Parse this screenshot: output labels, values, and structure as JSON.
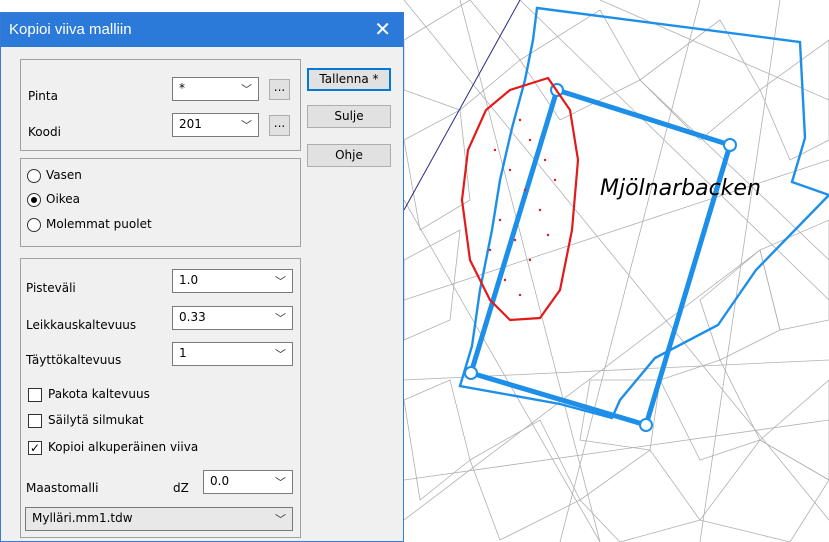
{
  "map": {
    "place_label": "Mjölnarbacken",
    "colors": {
      "tin": "#aaaaaa",
      "boundary": "#1e8fe8",
      "selection": "#ff0000",
      "axis": "#2a2a8c"
    }
  },
  "dialog": {
    "title": "Kopioi viiva malliin",
    "close_icon": "close-icon",
    "fields": {
      "pinta": {
        "label": "Pinta",
        "value": "*",
        "browse": "..."
      },
      "koodi": {
        "label": "Koodi",
        "value": "201",
        "browse": "..."
      }
    },
    "buttons": {
      "save": "Tallenna *",
      "close": "Sulje",
      "help": "Ohje"
    },
    "side": {
      "options": [
        {
          "label": "Vasen",
          "selected": false
        },
        {
          "label": "Oikea",
          "selected": true
        },
        {
          "label": "Molemmat puolet",
          "selected": false
        }
      ]
    },
    "params": {
      "pisteväli": {
        "label": "Pisteväli",
        "value": "1.0"
      },
      "leikkaus": {
        "label": "Leikkauskaltevuus",
        "value": "0.33"
      },
      "täyttö": {
        "label": "Täyttökaltevuus",
        "value": "1"
      }
    },
    "checks": {
      "pakota": {
        "label": "Pakota kaltevuus",
        "checked": false
      },
      "säilytä": {
        "label": "Säilytä silmukat",
        "checked": false
      },
      "kopioi": {
        "label": "Kopioi alkuperäinen viiva",
        "checked": true
      }
    },
    "maastomalli": {
      "label": "Maastomalli",
      "dz_label": "dZ",
      "dz_value": "0.0",
      "model": "Mylläri.mm1.tdw"
    }
  }
}
